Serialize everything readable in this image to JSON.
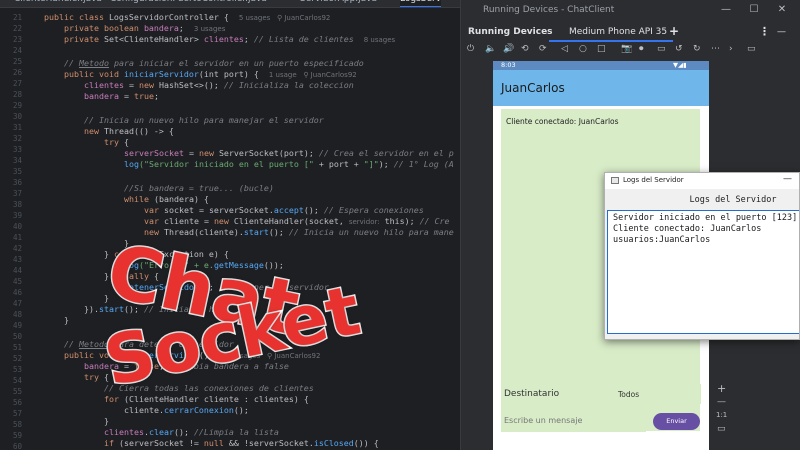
{
  "editor": {
    "tabs": [
      {
        "label": "ClienteHandler.java",
        "active": false
      },
      {
        "label": "ConfiguracionPuertoController.java",
        "active": false
      },
      {
        "label": "ServidorApp.java",
        "active": false
      },
      {
        "label": "LogsServ",
        "active": true
      }
    ],
    "line_numbers": [
      "21",
      "22",
      "23",
      "24",
      "25",
      "26",
      "27",
      "28",
      "29",
      "30",
      "31",
      "32",
      "33",
      "34",
      "35",
      "36",
      "37",
      "38",
      "39",
      "40",
      "41",
      "42",
      "43",
      "44",
      "45",
      "46",
      "47",
      "48",
      "49",
      "50",
      "51",
      "52",
      "53",
      "54",
      "55",
      "56",
      "57",
      "58",
      "59",
      "60"
    ],
    "code": {
      "l1_pre": "public class ",
      "l1_cls": "LogsServidorController",
      "l1_post": " {",
      "l1_hint": "5 usages   ⚲ JuanCarlos92",
      "l2_kw": "private boolean ",
      "l2_var": "bandera",
      "l2_post": ";",
      "l2_hint": "3 usages",
      "l3_kw": "private ",
      "l3_type": "Set<ClienteHandler> ",
      "l3_var": "clientes",
      "l3_post": "; ",
      "l3_cm": "// Lista de clientes",
      "l3_hint": "8 usages",
      "l5_cm1": "// ",
      "l5_cmu": "Metodo",
      "l5_cm2": " para iniciar el servidor en un puerto especificado",
      "l6_kw": "public void ",
      "l6_fn": "iniciarServidor",
      "l6_args": "(int port) {",
      "l6_hint": "1 usage   ⚲ JuanCarlos92",
      "l7_var": "clientes",
      "l7_mid": " = ",
      "l7_kw": "new ",
      "l7_fn": "HashSet",
      "l7_post": "<>(); ",
      "l7_cm": "// Inicializa la coleccion",
      "l8_var": "bandera",
      "l8_mid": " = ",
      "l8_kw": "true",
      "l8_post": ";",
      "l10_cm": "// Inicia un nuevo hilo para manejar el servidor",
      "l11_kw": "new ",
      "l11_post": "Thread(() -> {",
      "l12_kw": "try",
      "l12_post": " {",
      "l13_var": "serverSocket",
      "l13_mid": " = ",
      "l13_kw": "new ",
      "l13_fn": "ServerSocket",
      "l13_post": "(port); ",
      "l13_cm": "// Crea el servidor en el p",
      "l14_fn": "log",
      "l14_s1": "(\"Servidor iniciado en el puerto [\"",
      "l14_mid": " + port + ",
      "l14_s2": "\"]\"",
      "l14_post": "); ",
      "l14_cm": "// 1° Log (A",
      "l16_cm": "//Si bandera = true... (bucle)",
      "l17_kw": "while",
      "l17_post": " (bandera) {",
      "l18_kw": "var ",
      "l18_mid": "socket = serverSocket.",
      "l18_fn": "accept",
      "l18_post": "(); ",
      "l18_cm": "// Espera conexiones",
      "l19_kw": "var ",
      "l19_mid": "cliente = ",
      "l19_kw2": "new ",
      "l19_fn": "ClienteHandler",
      "l19_args": "(socket, ",
      "l19_hint": "servidor:",
      "l19_post": " this); ",
      "l19_cm": "// Cre",
      "l20_kw": "new ",
      "l20_post1": "Thread(cliente).",
      "l20_fn": "start",
      "l20_post2": "(); ",
      "l20_cm": "// Inicia un nuevo hilo para mane",
      "l21_post": "}",
      "l22_pre": "} ",
      "l22_kw": "catch",
      "l22_post": " (IOException e) {",
      "l23_fn": "log",
      "l23_post": "(\"Error: \" + e.",
      "l23_fn2": "getMessage",
      "l23_end": "());",
      "l24_pre": "} ",
      "l24_kw": "finally",
      "l24_post": " {",
      "l25_fn": "detenerServidor",
      "l25_post": "(); ",
      "l25_cm": "// Detener el servidor",
      "l26_post": "}",
      "l27_pre": "}).",
      "l27_fn": "start",
      "l27_post": "(); ",
      "l27_cm": "// Inicia el hilo",
      "l28_post": "}",
      "l30_cm1": "// ",
      "l30_cmu": "Metodo",
      "l30_cm2": " para detener el servidor",
      "l31_kw": "public void ",
      "l31_fn": "detenerServidor",
      "l31_post": "() {",
      "l31_hint": "2 usages   ⚲ JuanCarlos92",
      "l32_var": "bandera",
      "l32_mid": " = ",
      "l32_kw": "false",
      "l32_post": "; ",
      "l32_cm": "//Cambia bandera a false",
      "l33_kw": "try",
      "l33_post": " {",
      "l34_cm": "// Cierra todas las conexiones de clientes",
      "l35_kw": "for",
      "l35_post": " (ClienteHandler cliente : clientes) {",
      "l36_post": "cliente.",
      "l36_fn": "cerrarConexion",
      "l36_end": "();",
      "l37_post": "}",
      "l38_var": "clientes",
      "l38_post": ".",
      "l38_fn": "clear",
      "l38_end": "(); ",
      "l38_cm": "//Limpia la lista",
      "l39_kw": "if",
      "l39_post": " (serverSocket != ",
      "l39_kw2": "null",
      "l39_post2": " && !serverSocket.",
      "l39_fn": "isClosed",
      "l39_end": "()) {"
    }
  },
  "running_devices": {
    "window_title": "Running Devices - ChatClient",
    "panel_label": "Running Devices",
    "device_tab": "Medium Phone API 35",
    "add_icon": "+",
    "more_icon": "⋮",
    "minimize_icon": "—",
    "window_minimize": "—",
    "window_maximize": "☐",
    "window_close": "✕",
    "toolbar_icons": [
      "⏻",
      "🔈",
      "🔊",
      "⟲",
      "⟳",
      "◁",
      "○",
      "□",
      "📷",
      "⏺",
      "▭",
      "↺",
      "↻",
      "⋯",
      "›",
      "▭"
    ],
    "side_tools": [
      "+",
      "—",
      "1:1",
      "▭"
    ]
  },
  "phone": {
    "status_time": "8:03",
    "status_icons": "▼◢▮",
    "app_title": "JuanCarlos",
    "chat_messages": [
      "Cliente conectado: JuanCarlos"
    ],
    "recipient_placeholder": "Destinatario",
    "recipient_select": "Todos",
    "message_placeholder": "Escribe un mensaje",
    "send_label": "Enviar"
  },
  "logs_window": {
    "title": "Logs del Servidor",
    "heading": "Logs del Servidor",
    "minimize": "—",
    "lines": [
      "Servidor iniciado en el puerto [123]",
      "Cliente conectado: JuanCarlos",
      "usuarios:JuanCarlos"
    ]
  },
  "overlay": {
    "line1": "Chat",
    "line2": "Socket"
  }
}
